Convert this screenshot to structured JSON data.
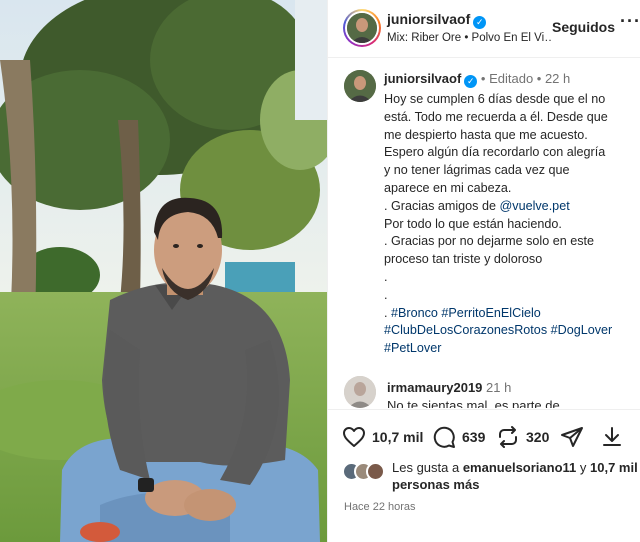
{
  "header": {
    "username": "juniorsilvaof",
    "music": "Mix: Riber Ore • Polvo En El Vi…",
    "follow_state": "Seguidos",
    "more": "···"
  },
  "caption": {
    "username": "juniorsilvaof",
    "meta": "• Editado • 22 h",
    "lines": [
      "Hoy se cumplen 6 días desde que el no",
      "está. Todo me recuerda a él. Desde que",
      "me despierto hasta que me acuesto.",
      "Espero algún día recordarlo con alegría",
      "y no tener lágrimas cada vez que",
      "aparece en mi cabeza."
    ],
    "thanks_prefix": ". Gracias amigos de ",
    "thanks_mention": "@vuelve.pet",
    "line_by_all": " Por todo lo que están haciendo.",
    "line_gracias_2a": ". Gracias por no dejarme solo en este",
    "line_gracias_2b": "proceso tan triste y doloroso",
    "dot1": ".",
    "dot2": ".",
    "hashtags_prefix": ". ",
    "hashtags_1": "#Bronco #PerritoEnElCielo",
    "hashtags_2": "#ClubDeLosCorazonesRotos #DogLover",
    "hashtags_3": "#PetLover"
  },
  "comment": {
    "username": "irmamaury2019",
    "time": "21 h",
    "text": "No te sientas mal, es parte de"
  },
  "actions": {
    "likes_count": "10,7 mil",
    "comments_count": "639",
    "reposts_count": "320",
    "liked_by_prefix": "Les gusta a ",
    "liked_by_user": "emanuelsoriano11",
    "liked_by_suffix": " y ",
    "liked_by_count": "10,7 mil",
    "liked_by_tail": "personas más",
    "time_ago": "Hace 22 horas"
  },
  "colors": {
    "link": "#00376b",
    "verified": "#0095f6",
    "text": "#262626",
    "muted": "#737373"
  },
  "icons": [
    "verified-icon",
    "heart-icon",
    "comment-icon",
    "repost-icon",
    "share-icon",
    "save-icon"
  ]
}
